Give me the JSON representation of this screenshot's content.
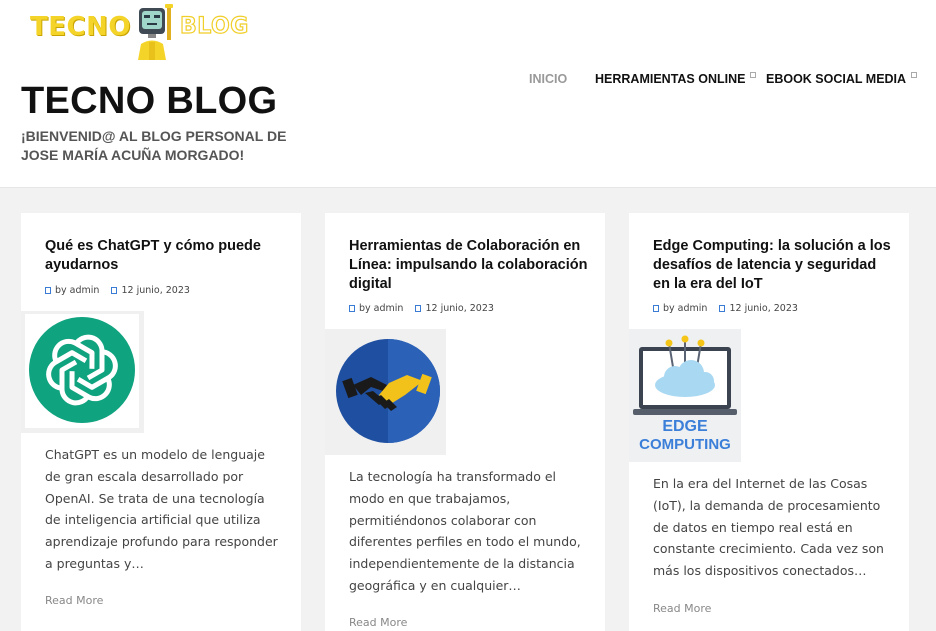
{
  "logo": {
    "left_text": "TECNO",
    "right_text": "BLOG"
  },
  "site": {
    "title": "TECNO BLOG",
    "tagline": "¡BIENVENID@ AL BLOG PERSONAL DE JOSE MARÍA ACUÑA MORGADO!"
  },
  "nav": {
    "items": [
      {
        "label": "INICIO"
      },
      {
        "label": "HERRAMIENTAS ONLINE"
      },
      {
        "label": "EBOOK SOCIAL MEDIA"
      }
    ]
  },
  "posts": [
    {
      "title": "Qué es ChatGPT y cómo puede ayudarnos",
      "author": "by admin",
      "date": "12 junio, 2023",
      "excerpt": "ChatGPT es un modelo de lenguaje de gran escala desarrollado por OpenAI. Se trata de una tecnología de inteligencia artificial que utiliza aprendizaje profundo para responder a preguntas y…",
      "read_more": "Read More"
    },
    {
      "title": "Herramientas de Colaboración en Línea: impulsando la colaboración digital",
      "author": "by admin",
      "date": "12 junio, 2023",
      "excerpt": "La tecnología ha transformado el modo en que trabajamos, permitiéndonos colaborar con diferentes perfiles en todo el mundo, independientemente de la distancia geográfica y en cualquier…",
      "read_more": "Read More"
    },
    {
      "title": "Edge Computing: la solución a los desafíos de latencia y seguridad en la era del IoT",
      "author": "by admin",
      "date": "12 junio, 2023",
      "thumb_text_line1": "EDGE",
      "thumb_text_line2": "COMPUTING",
      "excerpt": "En la era del Internet de las Cosas (IoT), la demanda de procesamiento de datos en tiempo real está en constante crecimiento. Cada vez son más los dispositivos conectados…",
      "read_more": "Read More"
    }
  ],
  "colors": {
    "accent_yellow": "#f5d42a",
    "openai_green": "#10a37f",
    "meta_icon_blue": "#3a7bd5"
  }
}
